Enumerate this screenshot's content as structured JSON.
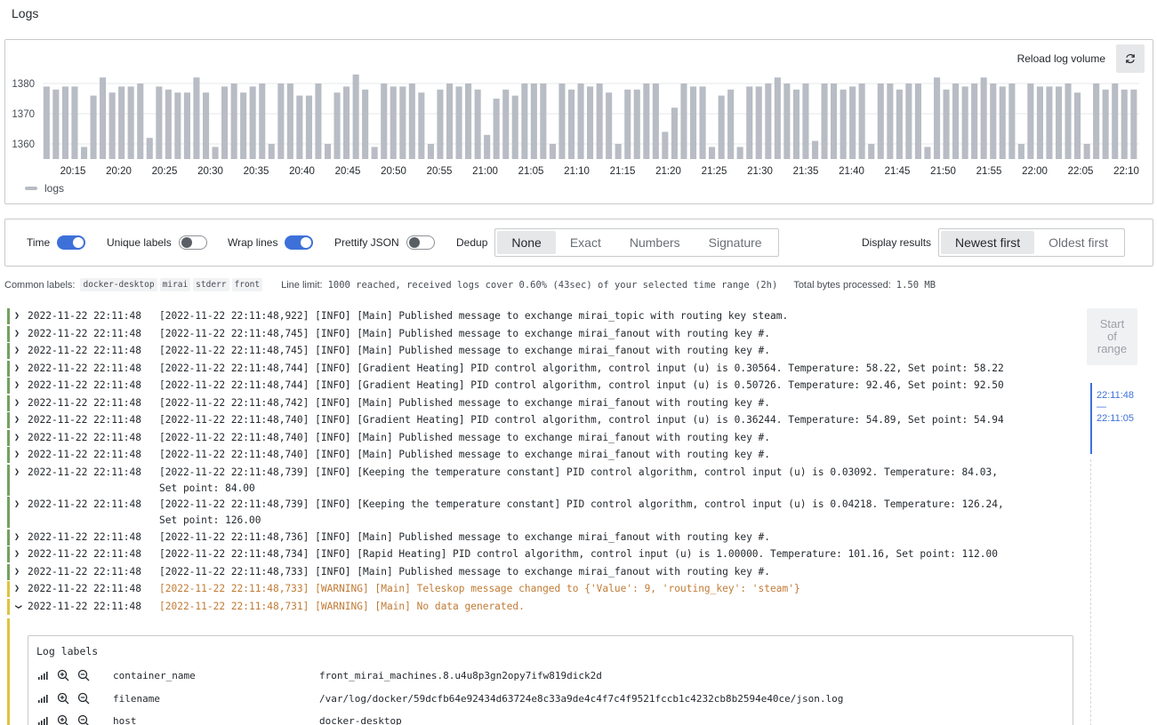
{
  "page": {
    "title": "Logs"
  },
  "volume": {
    "reload_label": "Reload log volume",
    "legend_label": "logs",
    "colors": {
      "bar": "#b8bcc4",
      "grid": "#e6e7e9"
    }
  },
  "chart_data": {
    "type": "bar",
    "ylim": [
      1355,
      1385
    ],
    "yticks": [
      "1380",
      "1370",
      "1360"
    ],
    "ytick_values": [
      1380,
      1370,
      1360
    ],
    "xtick_labels": [
      "20:15",
      "20:20",
      "20:25",
      "20:30",
      "20:35",
      "20:40",
      "20:45",
      "20:50",
      "20:55",
      "21:00",
      "21:05",
      "21:10",
      "21:15",
      "21:20",
      "21:25",
      "21:30",
      "21:35",
      "21:40",
      "21:45",
      "21:50",
      "21:55",
      "22:00",
      "22:05",
      "22:10"
    ],
    "series": [
      {
        "name": "logs",
        "values": [
          1379,
          1378,
          1379,
          1379,
          1359,
          1376,
          1382,
          1377,
          1379,
          1379,
          1380,
          1362,
          1379,
          1378,
          1377,
          1377,
          1382,
          1377,
          1359,
          1379,
          1380,
          1377,
          1379,
          1380,
          1360,
          1380,
          1380,
          1376,
          1376,
          1380,
          1360,
          1377,
          1379,
          1383,
          1378,
          1359,
          1380,
          1379,
          1379,
          1380,
          1377,
          1360,
          1378,
          1380,
          1379,
          1380,
          1378,
          1363,
          1375,
          1378,
          1376,
          1380,
          1380,
          1380,
          1360,
          1380,
          1378,
          1380,
          1379,
          1380,
          1377,
          1360,
          1378,
          1378,
          1380,
          1380,
          1364,
          1372,
          1380,
          1379,
          1379,
          1359,
          1376,
          1378,
          1359,
          1379,
          1379,
          1380,
          1382,
          1380,
          1378,
          1380,
          1361,
          1380,
          1380,
          1378,
          1379,
          1380,
          1360,
          1380,
          1380,
          1378,
          1380,
          1380,
          1359,
          1382,
          1378,
          1380,
          1379,
          1380,
          1382,
          1380,
          1379,
          1380,
          1360,
          1380,
          1379,
          1379,
          1379,
          1380,
          1377,
          1360,
          1380,
          1378,
          1380,
          1378,
          1378
        ]
      }
    ]
  },
  "options": {
    "time_label": "Time",
    "unique_labels_label": "Unique labels",
    "wrap_lines_label": "Wrap lines",
    "prettify_json_label": "Prettify JSON",
    "dedup_label": "Dedup",
    "dedup_options": [
      "None",
      "Exact",
      "Numbers",
      "Signature"
    ],
    "display_results_label": "Display results",
    "order_options": [
      "Newest first",
      "Oldest first"
    ]
  },
  "meta": {
    "common_labels_label": "Common labels:",
    "common_labels": [
      "docker-desktop",
      "mirai",
      "stderr",
      "front"
    ],
    "line_limit_label": "Line limit:",
    "line_limit_value": "1000 reached, received logs cover 0.60% (43sec) of your selected time range (2h)",
    "bytes_label": "Total bytes processed:",
    "bytes_value": "1.50 MB"
  },
  "logs": [
    {
      "ts": "2022-11-22 22:11:48",
      "msg": "[2022-11-22 22:11:48,922] [INFO] [Main] Published message to exchange mirai_topic with routing key steam."
    },
    {
      "ts": "2022-11-22 22:11:48",
      "msg": "[2022-11-22 22:11:48,745] [INFO] [Main] Published message to exchange mirai_fanout with routing key #."
    },
    {
      "ts": "2022-11-22 22:11:48",
      "msg": "[2022-11-22 22:11:48,745] [INFO] [Main] Published message to exchange mirai_fanout with routing key #."
    },
    {
      "ts": "2022-11-22 22:11:48",
      "msg": "[2022-11-22 22:11:48,744] [INFO] [Gradient Heating] PID control algorithm, control input (u) is 0.30564. Temperature: 58.22, Set point: 58.22"
    },
    {
      "ts": "2022-11-22 22:11:48",
      "msg": "[2022-11-22 22:11:48,744] [INFO] [Gradient Heating] PID control algorithm, control input (u) is 0.50726. Temperature: 92.46, Set point: 92.50"
    },
    {
      "ts": "2022-11-22 22:11:48",
      "msg": "[2022-11-22 22:11:48,742] [INFO] [Main] Published message to exchange mirai_fanout with routing key #."
    },
    {
      "ts": "2022-11-22 22:11:48",
      "msg": "[2022-11-22 22:11:48,740] [INFO] [Gradient Heating] PID control algorithm, control input (u) is 0.36244. Temperature: 54.89, Set point: 54.94"
    },
    {
      "ts": "2022-11-22 22:11:48",
      "msg": "[2022-11-22 22:11:48,740] [INFO] [Main] Published message to exchange mirai_fanout with routing key #."
    },
    {
      "ts": "2022-11-22 22:11:48",
      "msg": "[2022-11-22 22:11:48,740] [INFO] [Main] Published message to exchange mirai_fanout with routing key #."
    },
    {
      "ts": "2022-11-22 22:11:48",
      "msg": "[2022-11-22 22:11:48,739] [INFO] [Keeping the temperature constant] PID control algorithm, control input (u) is 0.03092. Temperature: 84.03,",
      "msg2": "Set point: 84.00"
    },
    {
      "ts": "2022-11-22 22:11:48",
      "msg": "[2022-11-22 22:11:48,739] [INFO] [Keeping the temperature constant] PID control algorithm, control input (u) is 0.04218. Temperature: 126.24,",
      "msg2": "Set point: 126.00"
    },
    {
      "ts": "2022-11-22 22:11:48",
      "msg": "[2022-11-22 22:11:48,736] [INFO] [Main] Published message to exchange mirai_fanout with routing key #."
    },
    {
      "ts": "2022-11-22 22:11:48",
      "msg": "[2022-11-22 22:11:48,734] [INFO] [Rapid Heating] PID control algorithm, control input (u) is 1.00000. Temperature: 101.16, Set point: 112.00"
    },
    {
      "ts": "2022-11-22 22:11:48",
      "msg": "[2022-11-22 22:11:48,733] [INFO] [Main] Published message to exchange mirai_fanout with routing key #."
    },
    {
      "ts": "2022-11-22 22:11:48",
      "msg": "[2022-11-22 22:11:48,733] [WARNING] [Main] Teleskop message changed to {'Value': 9, 'routing_key': 'steam'}"
    },
    {
      "ts": "2022-11-22 22:11:48",
      "msg": "[2022-11-22 22:11:48,731] [WARNING] [Main] No data generated."
    }
  ],
  "detail": {
    "title": "Log labels",
    "labels": [
      {
        "key": "container_name",
        "value": "front_mirai_machines.8.u4u8p3gn2opy7ifw819dick2d"
      },
      {
        "key": "filename",
        "value": "/var/log/docker/59dcfb64e92434d63724e8c33a9de4c4f7c4f9521fccb1c4232cb8b2594e40ce/json.log"
      },
      {
        "key": "host",
        "value": "docker-desktop"
      }
    ]
  },
  "range": {
    "start_label_1": "Start",
    "start_label_2": "of",
    "start_label_3": "range",
    "top_time": "22:11:48",
    "dash": "—",
    "bottom_time": "22:11:05"
  }
}
